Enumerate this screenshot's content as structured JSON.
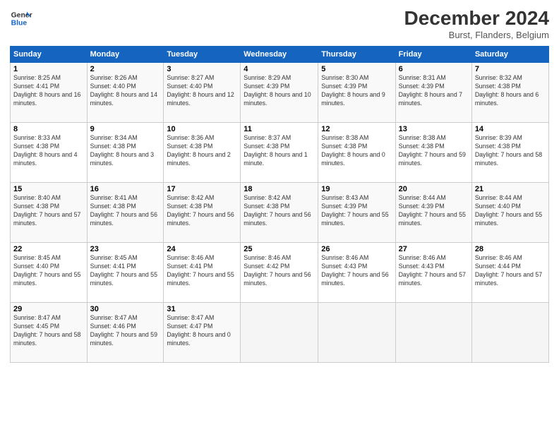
{
  "header": {
    "logo_line1": "General",
    "logo_line2": "Blue",
    "month_year": "December 2024",
    "location": "Burst, Flanders, Belgium"
  },
  "weekdays": [
    "Sunday",
    "Monday",
    "Tuesday",
    "Wednesday",
    "Thursday",
    "Friday",
    "Saturday"
  ],
  "weeks": [
    [
      {
        "day": 1,
        "sunrise": "8:25 AM",
        "sunset": "4:41 PM",
        "daylight": "8 hours and 16 minutes."
      },
      {
        "day": 2,
        "sunrise": "8:26 AM",
        "sunset": "4:40 PM",
        "daylight": "8 hours and 14 minutes."
      },
      {
        "day": 3,
        "sunrise": "8:27 AM",
        "sunset": "4:40 PM",
        "daylight": "8 hours and 12 minutes."
      },
      {
        "day": 4,
        "sunrise": "8:29 AM",
        "sunset": "4:39 PM",
        "daylight": "8 hours and 10 minutes."
      },
      {
        "day": 5,
        "sunrise": "8:30 AM",
        "sunset": "4:39 PM",
        "daylight": "8 hours and 9 minutes."
      },
      {
        "day": 6,
        "sunrise": "8:31 AM",
        "sunset": "4:39 PM",
        "daylight": "8 hours and 7 minutes."
      },
      {
        "day": 7,
        "sunrise": "8:32 AM",
        "sunset": "4:38 PM",
        "daylight": "8 hours and 6 minutes."
      }
    ],
    [
      {
        "day": 8,
        "sunrise": "8:33 AM",
        "sunset": "4:38 PM",
        "daylight": "8 hours and 4 minutes."
      },
      {
        "day": 9,
        "sunrise": "8:34 AM",
        "sunset": "4:38 PM",
        "daylight": "8 hours and 3 minutes."
      },
      {
        "day": 10,
        "sunrise": "8:36 AM",
        "sunset": "4:38 PM",
        "daylight": "8 hours and 2 minutes."
      },
      {
        "day": 11,
        "sunrise": "8:37 AM",
        "sunset": "4:38 PM",
        "daylight": "8 hours and 1 minute."
      },
      {
        "day": 12,
        "sunrise": "8:38 AM",
        "sunset": "4:38 PM",
        "daylight": "8 hours and 0 minutes."
      },
      {
        "day": 13,
        "sunrise": "8:38 AM",
        "sunset": "4:38 PM",
        "daylight": "7 hours and 59 minutes."
      },
      {
        "day": 14,
        "sunrise": "8:39 AM",
        "sunset": "4:38 PM",
        "daylight": "7 hours and 58 minutes."
      }
    ],
    [
      {
        "day": 15,
        "sunrise": "8:40 AM",
        "sunset": "4:38 PM",
        "daylight": "7 hours and 57 minutes."
      },
      {
        "day": 16,
        "sunrise": "8:41 AM",
        "sunset": "4:38 PM",
        "daylight": "7 hours and 56 minutes."
      },
      {
        "day": 17,
        "sunrise": "8:42 AM",
        "sunset": "4:38 PM",
        "daylight": "7 hours and 56 minutes."
      },
      {
        "day": 18,
        "sunrise": "8:42 AM",
        "sunset": "4:38 PM",
        "daylight": "7 hours and 56 minutes."
      },
      {
        "day": 19,
        "sunrise": "8:43 AM",
        "sunset": "4:39 PM",
        "daylight": "7 hours and 55 minutes."
      },
      {
        "day": 20,
        "sunrise": "8:44 AM",
        "sunset": "4:39 PM",
        "daylight": "7 hours and 55 minutes."
      },
      {
        "day": 21,
        "sunrise": "8:44 AM",
        "sunset": "4:40 PM",
        "daylight": "7 hours and 55 minutes."
      }
    ],
    [
      {
        "day": 22,
        "sunrise": "8:45 AM",
        "sunset": "4:40 PM",
        "daylight": "7 hours and 55 minutes."
      },
      {
        "day": 23,
        "sunrise": "8:45 AM",
        "sunset": "4:41 PM",
        "daylight": "7 hours and 55 minutes."
      },
      {
        "day": 24,
        "sunrise": "8:46 AM",
        "sunset": "4:41 PM",
        "daylight": "7 hours and 55 minutes."
      },
      {
        "day": 25,
        "sunrise": "8:46 AM",
        "sunset": "4:42 PM",
        "daylight": "7 hours and 56 minutes."
      },
      {
        "day": 26,
        "sunrise": "8:46 AM",
        "sunset": "4:43 PM",
        "daylight": "7 hours and 56 minutes."
      },
      {
        "day": 27,
        "sunrise": "8:46 AM",
        "sunset": "4:43 PM",
        "daylight": "7 hours and 57 minutes."
      },
      {
        "day": 28,
        "sunrise": "8:46 AM",
        "sunset": "4:44 PM",
        "daylight": "7 hours and 57 minutes."
      }
    ],
    [
      {
        "day": 29,
        "sunrise": "8:47 AM",
        "sunset": "4:45 PM",
        "daylight": "7 hours and 58 minutes."
      },
      {
        "day": 30,
        "sunrise": "8:47 AM",
        "sunset": "4:46 PM",
        "daylight": "7 hours and 59 minutes."
      },
      {
        "day": 31,
        "sunrise": "8:47 AM",
        "sunset": "4:47 PM",
        "daylight": "8 hours and 0 minutes."
      },
      null,
      null,
      null,
      null
    ]
  ]
}
